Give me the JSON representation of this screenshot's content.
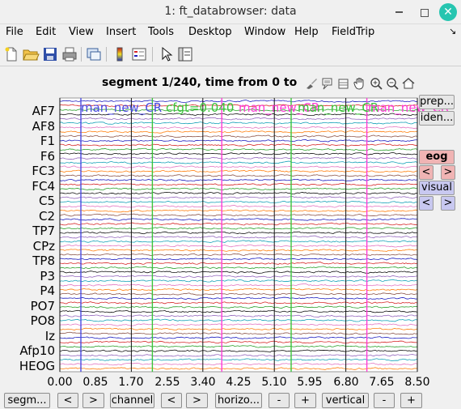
{
  "window": {
    "title": "1: ft_databrowser: data",
    "close_glyph": "✕"
  },
  "menu": [
    "File",
    "Edit",
    "View",
    "Insert",
    "Tools",
    "Desktop",
    "Window",
    "Help",
    "FieldTrip"
  ],
  "menu_pin": "↘",
  "toolbar_icons": [
    "new-file-icon",
    "open-folder-icon",
    "save-icon",
    "print-icon",
    "link-plot-icon",
    "colorbar-icon",
    "legend-icon",
    "pointer-icon",
    "property-inspector-icon"
  ],
  "axes_toolbar_icons": [
    "brush-icon",
    "data-tips-icon",
    "rotate-icon",
    "pan-icon",
    "zoom-in-icon",
    "zoom-out-icon",
    "home-icon"
  ],
  "plot": {
    "title": "segment 1/240, time from 0 to",
    "channels": [
      "AF7",
      "AF8",
      "F1",
      "F6",
      "FC3",
      "FC4",
      "C5",
      "C2",
      "TP7",
      "CPz",
      "TP8",
      "P3",
      "P4",
      "PO7",
      "PO8",
      "Iz",
      "Afp10",
      "HEOG"
    ],
    "x_ticks": [
      "0.00",
      "0.85",
      "1.70",
      "2.55",
      "3.40",
      "4.25",
      "5.10",
      "5.95",
      "6.80",
      "7.65",
      "8.50"
    ],
    "xlim": [
      0,
      8.5
    ],
    "event_lines": [
      {
        "x": 0.5,
        "color": "#4a4ae0"
      },
      {
        "x": 2.2,
        "color": "#3ac43a"
      },
      {
        "x": 3.85,
        "color": "#ff3bd6"
      },
      {
        "x": 5.5,
        "color": "#3ac43a"
      },
      {
        "x": 7.3,
        "color": "#ff3bd6"
      }
    ],
    "segment_lines": [
      0,
      1.7,
      3.4,
      5.1,
      6.8,
      8.5
    ],
    "event_labels": [
      {
        "text": "man_new_CR",
        "color": "#4a4ae0"
      },
      {
        "text": "cfgt=0.040",
        "color": "#3ac43a"
      },
      {
        "text": "man_new_CR",
        "color": "#ff3bd6"
      },
      {
        "text": "man_new_CR",
        "color": "#3ac43a"
      },
      {
        "text": "man_new_CR",
        "color": "#ff3bd6"
      }
    ]
  },
  "side_panel": {
    "preproc_label": "prep...",
    "identify_label": "iden...",
    "eog_label": "eog",
    "eog_prev": "<",
    "eog_next": ">",
    "visual_label": "visual",
    "visual_prev": "<",
    "visual_next": ">"
  },
  "bottom_controls": {
    "segment_label": "segm...",
    "segment_prev": "<",
    "segment_next": ">",
    "channel_label": "channel",
    "channel_prev": "<",
    "channel_next": ">",
    "horizontal_label": "horizo...",
    "horizontal_minus": "-",
    "horizontal_plus": "+",
    "vertical_label": "vertical",
    "vertical_minus": "-",
    "vertical_plus": "+"
  },
  "colors": {
    "trace_palette": [
      "#1f1fbf",
      "#d62728",
      "#2ca02c",
      "#111111",
      "#9467bd",
      "#17a2b8",
      "#e377c2",
      "#ff7f0e",
      "#8c564b"
    ],
    "eog_accent": "#f0b4b4",
    "visual_accent": "#c8c8f0"
  }
}
